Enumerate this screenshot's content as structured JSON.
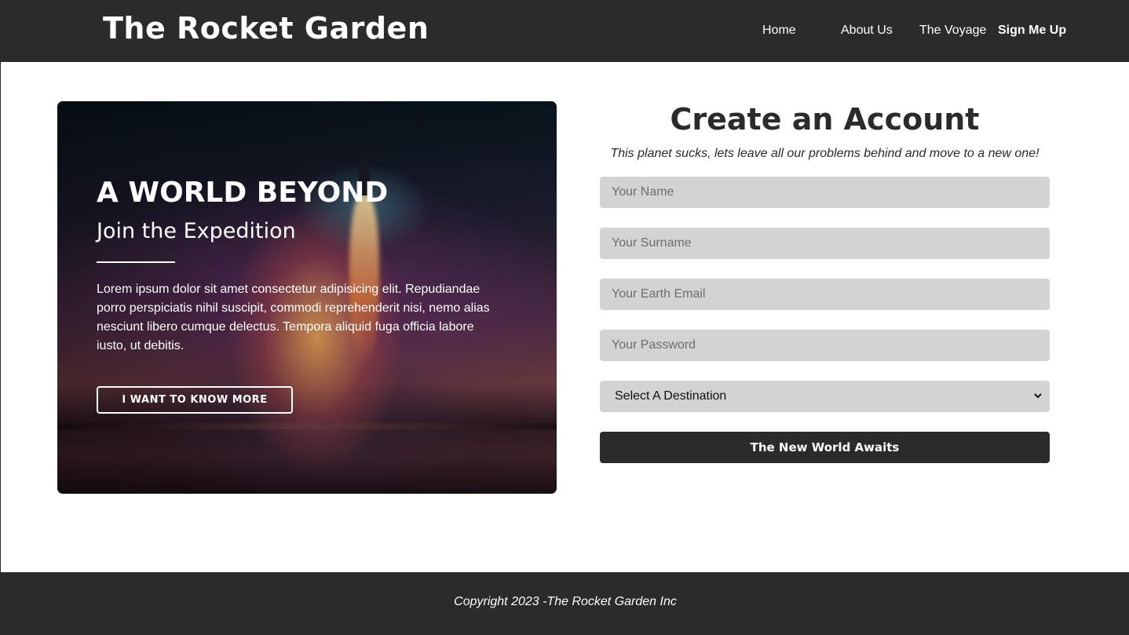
{
  "header": {
    "brand": "The Rocket Garden",
    "nav": [
      "Home",
      "About Us",
      "The Voyage",
      "Sign Me Up"
    ],
    "active": "Sign Me Up"
  },
  "hero": {
    "title": "A WORLD BEYOND",
    "subtitle": "Join the Expedition",
    "body": "Lorem ipsum dolor sit amet consectetur adipisicing elit. Repudiandae porro perspiciatis nihil suscipit, commodi reprehenderit nisi, nemo alias nesciunt libero cumque delectus. Tempora aliquid fuga officia labore iusto, ut debitis.",
    "button": "I WANT TO KNOW MORE"
  },
  "form": {
    "title": "Create an Account",
    "subtitle": "This planet sucks, lets leave all our problems behind and move to a new one!",
    "name_placeholder": "Your Name",
    "surname_placeholder": "Your Surname",
    "email_placeholder": "Your Earth Email",
    "password_placeholder": "Your Password",
    "destination_selected": "Select A Destination",
    "submit": "The New World Awaits"
  },
  "footer": {
    "copyright": "Copyright 2023 -The Rocket Garden Inc"
  },
  "colors": {
    "dark": "#2b2b2b",
    "input_bg": "#d3d3d3",
    "white": "#ffffff"
  }
}
